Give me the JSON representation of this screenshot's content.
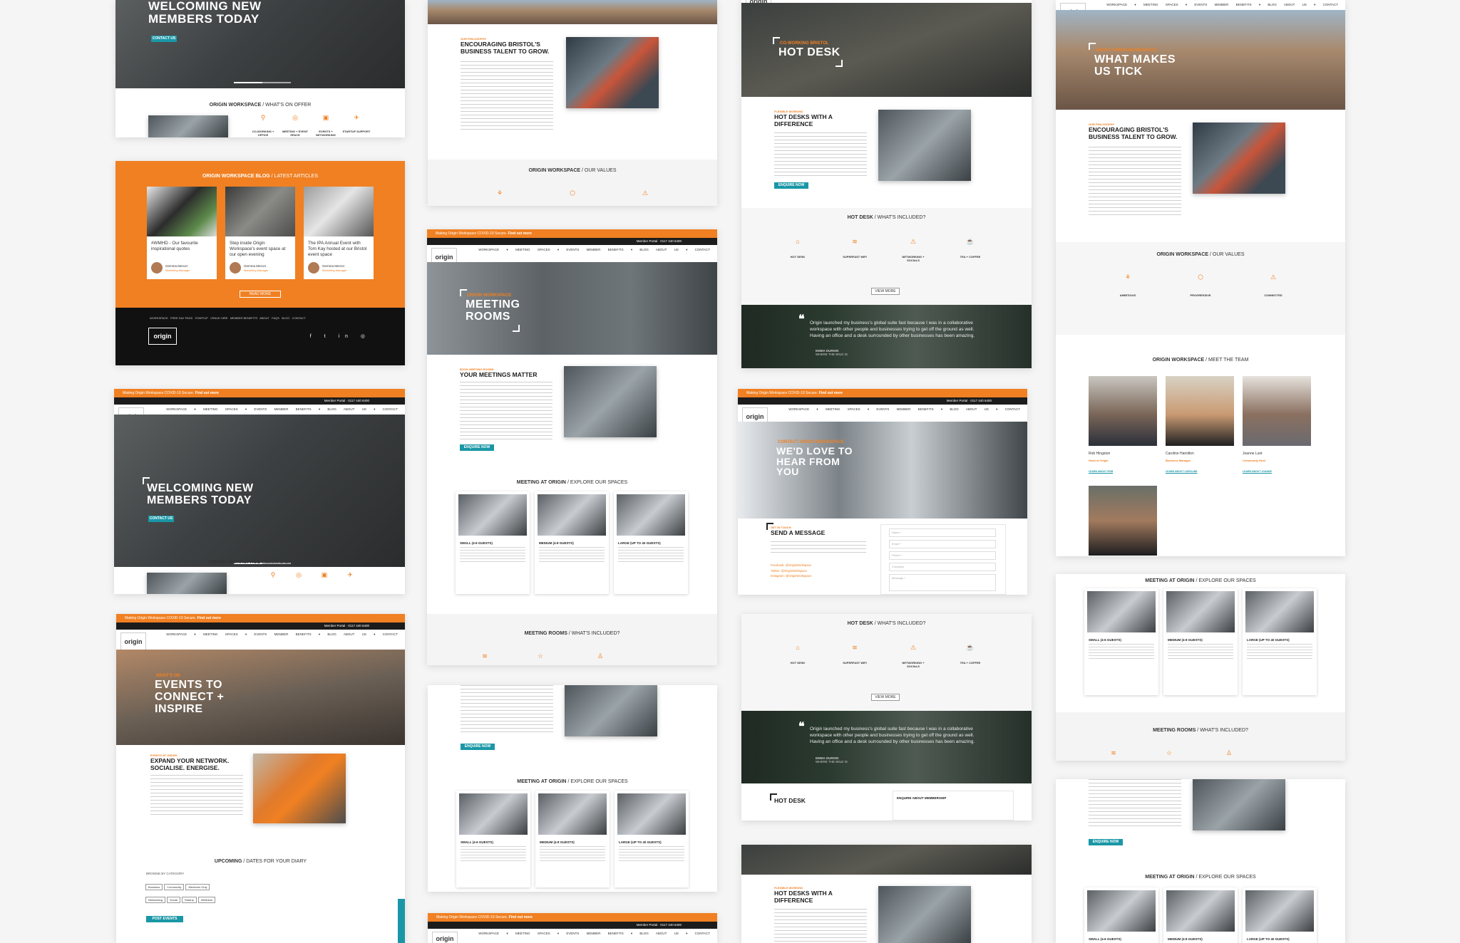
{
  "colors": {
    "accent": "#f08022",
    "teal": "#1a97a6",
    "dark": "#111111"
  },
  "common": {
    "logo": "origin",
    "banner": "Making Origin Workspace COVID-19 Secure.",
    "banner_link": "Find out more",
    "member_portal": "Member Portal",
    "phone": "0117 440 6400",
    "search_placeholder": "Search",
    "nav": [
      "WORKSPACE",
      "MEETING SPACES",
      "EVENTS",
      "MEMBER BENEFITS",
      "BLOG",
      "ABOUT US",
      "CONTACT"
    ],
    "nav_string": "WORKSPACE ▾ MEETING SPACES ▾ EVENTS MEMBER BENEFITS ▾ BLOG ABOUT US ▾ CONTACT"
  },
  "home": {
    "title_line1": "WELCOMING NEW",
    "title_line2": "MEMBERS TODAY",
    "contact_btn": "CONTACT US",
    "offer_title": "ORIGIN WORKSPACE",
    "offer_sub": " / WHAT'S ON OFFER",
    "offer_items": [
      "CO-WORKING + OFFICE",
      "MEETING + EVENT SPACE",
      "EVENTS + NETWORKING",
      "STARTUP SUPPORT"
    ]
  },
  "blog": {
    "title": "ORIGIN WORKSPACE BLOG",
    "sub": " / LATEST ARTICLES",
    "posts": [
      {
        "text": "#WMHD - Our favourite inspirational quotes",
        "author": "Gemma Mercer",
        "role": "Marketing Manager"
      },
      {
        "text": "Step inside Origin Workspace's event space at our open evening",
        "author": "Gemma Mercer",
        "role": "Marketing Manager"
      },
      {
        "text": "The IPA Annual Event with Tom Kay hosted at our Bristol event space",
        "author": "Gemma Mercer",
        "role": "Marketing Manager"
      }
    ],
    "read_more": "READ MORE",
    "footer_links": "WORKSPACE   FREE DAY PASS   STARTUP   VENUE HIRE   MEMBER BENEFITS   ABOUT   FAQS   BLOG   CONTACT"
  },
  "events": {
    "kicker": "WHAT'S ON",
    "title_l1": "EVENTS TO",
    "title_l2": "CONNECT +",
    "title_l3": "INSPIRE",
    "kick2": "EVENTS AT ORIGIN",
    "heading_l1": "EXPAND YOUR NETWORK.",
    "heading_l2": "SOCIALISE. ENERGISE.",
    "upcoming": "UPCOMING",
    "upcoming_sub": " / DATES FOR YOUR DIARY",
    "browse": "BROWSE BY CATEGORY",
    "tags": [
      "Business",
      "Community",
      "Members Only",
      "Networking",
      "Social",
      "Startup",
      "Wellness"
    ],
    "post_btn": "POST EVENTS"
  },
  "about": {
    "kicker": "OUR PHILOSOPHY",
    "heading_l1": "ENCOURAGING BRISTOL'S",
    "heading_l2": "BUSINESS TALENT TO GROW.",
    "values_title": "ORIGIN WORKSPACE",
    "values_sub": " / OUR VALUES",
    "values": [
      "AMBITIOUS",
      "PROGRESSIVE",
      "CONNECTED"
    ],
    "hero_kicker": "ABOUT ORIGIN WORKSPACE",
    "hero_l1": "WHAT MAKES",
    "hero_l2": "US TICK",
    "team_title": "ORIGIN WORKSPACE",
    "team_sub": " / MEET THE TEAM",
    "team": [
      {
        "name": "Rob Hingston",
        "role": "Head of Origin",
        "link": "LEARN ABOUT ROB"
      },
      {
        "name": "Caroline Hamilton",
        "role": "Business Manager",
        "link": "LEARN ABOUT CAROLINE"
      },
      {
        "name": "Joanne Lunt",
        "role": "Community Host",
        "link": "LEARN ABOUT JOANNE"
      }
    ]
  },
  "rooms": {
    "kicker": "ORIGIN WORKSPACE",
    "title_l1": "MEETING",
    "title_l2": "ROOMS",
    "kick2": "BOOK MEETING ROOMS",
    "heading": "YOUR MEETINGS MATTER",
    "enquire": "ENQUIRE NOW",
    "explore_title": "MEETING AT ORIGIN",
    "explore_sub": " / EXPLORE OUR SPACES",
    "cards": [
      "SMALL (4-6 GUESTS)",
      "MEDIUM (4-8 GUESTS)",
      "LARGE (UP TO 40 GUESTS)"
    ],
    "included_title": "MEETING ROOMS",
    "included_sub": " / WHAT'S INCLUDED?"
  },
  "desk": {
    "kicker": "CO-WORKING BRISTOL",
    "title": "HOT DESK",
    "kick2": "FLEXIBLE WORKING",
    "heading_l1": "HOT DESKS WITH A",
    "heading_l2": "DIFFERENCE",
    "enquire": "ENQUIRE NOW",
    "inc_title": "HOT DESK",
    "inc_sub": " / WHAT'S INCLUDED?",
    "features": [
      "HOT DESK",
      "SUPERFAST WIFI",
      "NETWORKING + SOCIALS",
      "TEA + COFFEE"
    ],
    "view_more": "VIEW MORE",
    "quote_l1": "Origin launched my business's global suite fast because I was in a collaborative",
    "quote_l2": "workspace with other people and businesses trying to get off the ground as well.",
    "quote_l3": "Having an office and a desk surrounded by other businesses has been amazing.",
    "quote_author": "EMMA DURKIN",
    "quote_company": "WHERE THE WILD IS",
    "enquire_membership": "ENQUIRE ABOUT MEMBERSHIP"
  },
  "contact": {
    "kicker": "CONTACT ORIGIN WORKSPACE",
    "title_l1": "WE'D LOVE TO",
    "title_l2": "HEAR FROM",
    "title_l3": "YOU",
    "kick2": "GET IN TOUCH",
    "heading": "SEND A MESSAGE",
    "fields": [
      "Name *",
      "Email *",
      "Phone *",
      "Company",
      "Message *"
    ],
    "social": [
      "Facebook: @OriginWorkspace",
      "Twitter: @OriginWorkspace",
      "Instagram: @OriginWorkspace"
    ]
  }
}
